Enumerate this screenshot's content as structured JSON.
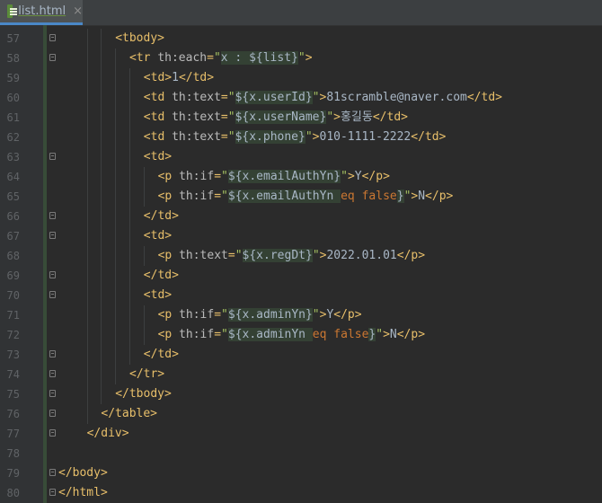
{
  "tab": {
    "filename": "list.html",
    "close": "×"
  },
  "editor": {
    "lines": [
      {
        "num": "57",
        "indent": 8,
        "fold": true,
        "tokens": [
          [
            "tag",
            "<tbody>"
          ]
        ]
      },
      {
        "num": "58",
        "indent": 10,
        "fold": true,
        "tokens": [
          [
            "tag",
            "<tr "
          ],
          [
            "attr",
            "th:each"
          ],
          [
            "tag",
            "="
          ],
          [
            "str",
            "\""
          ],
          [
            "expr",
            "x : ${list}"
          ],
          [
            "str",
            "\""
          ],
          [
            "tag",
            ">"
          ]
        ]
      },
      {
        "num": "59",
        "indent": 12,
        "fold": false,
        "tokens": [
          [
            "tag",
            "<td>"
          ],
          [
            "text",
            "1"
          ],
          [
            "tag",
            "</td>"
          ]
        ]
      },
      {
        "num": "60",
        "indent": 12,
        "fold": false,
        "tokens": [
          [
            "tag",
            "<td "
          ],
          [
            "attr",
            "th:text"
          ],
          [
            "tag",
            "="
          ],
          [
            "str",
            "\""
          ],
          [
            "expr",
            "${x.userId}"
          ],
          [
            "str",
            "\""
          ],
          [
            "tag",
            ">"
          ],
          [
            "text",
            "81scramble@naver.com"
          ],
          [
            "tag",
            "</td>"
          ]
        ]
      },
      {
        "num": "61",
        "indent": 12,
        "fold": false,
        "tokens": [
          [
            "tag",
            "<td "
          ],
          [
            "attr",
            "th:text"
          ],
          [
            "tag",
            "="
          ],
          [
            "str",
            "\""
          ],
          [
            "expr",
            "${x.userName}"
          ],
          [
            "str",
            "\""
          ],
          [
            "tag",
            ">"
          ],
          [
            "text",
            "홍길동"
          ],
          [
            "tag",
            "</td>"
          ]
        ]
      },
      {
        "num": "62",
        "indent": 12,
        "fold": false,
        "tokens": [
          [
            "tag",
            "<td "
          ],
          [
            "attr",
            "th:text"
          ],
          [
            "tag",
            "="
          ],
          [
            "str",
            "\""
          ],
          [
            "expr",
            "${x.phone}"
          ],
          [
            "str",
            "\""
          ],
          [
            "tag",
            ">"
          ],
          [
            "text",
            "010-1111-2222"
          ],
          [
            "tag",
            "</td>"
          ]
        ]
      },
      {
        "num": "63",
        "indent": 12,
        "fold": true,
        "tokens": [
          [
            "tag",
            "<td>"
          ]
        ]
      },
      {
        "num": "64",
        "indent": 14,
        "fold": false,
        "tokens": [
          [
            "tag",
            "<p "
          ],
          [
            "attr",
            "th:if"
          ],
          [
            "tag",
            "="
          ],
          [
            "str",
            "\""
          ],
          [
            "expr",
            "${x.emailAuthYn}"
          ],
          [
            "str",
            "\""
          ],
          [
            "tag",
            ">"
          ],
          [
            "text",
            "Y"
          ],
          [
            "tag",
            "</p>"
          ]
        ]
      },
      {
        "num": "65",
        "indent": 14,
        "fold": false,
        "tokens": [
          [
            "tag",
            "<p "
          ],
          [
            "attr",
            "th:if"
          ],
          [
            "tag",
            "="
          ],
          [
            "str",
            "\""
          ],
          [
            "expr",
            "${x.emailAuthYn "
          ],
          [
            "kw",
            "eq false"
          ],
          [
            "expr",
            "}"
          ],
          [
            "str",
            "\""
          ],
          [
            "tag",
            ">"
          ],
          [
            "text",
            "N"
          ],
          [
            "tag",
            "</p>"
          ]
        ]
      },
      {
        "num": "66",
        "indent": 12,
        "fold": true,
        "tokens": [
          [
            "tag",
            "</td>"
          ]
        ]
      },
      {
        "num": "67",
        "indent": 12,
        "fold": true,
        "tokens": [
          [
            "tag",
            "<td>"
          ]
        ]
      },
      {
        "num": "68",
        "indent": 14,
        "fold": false,
        "tokens": [
          [
            "tag",
            "<p "
          ],
          [
            "attr",
            "th:text"
          ],
          [
            "tag",
            "="
          ],
          [
            "str",
            "\""
          ],
          [
            "expr",
            "${x.regDt}"
          ],
          [
            "str",
            "\""
          ],
          [
            "tag",
            ">"
          ],
          [
            "text",
            "2022.01.01"
          ],
          [
            "tag",
            "</p>"
          ]
        ]
      },
      {
        "num": "69",
        "indent": 12,
        "fold": true,
        "tokens": [
          [
            "tag",
            "</td>"
          ]
        ]
      },
      {
        "num": "70",
        "indent": 12,
        "fold": true,
        "tokens": [
          [
            "tag",
            "<td>"
          ]
        ]
      },
      {
        "num": "71",
        "indent": 14,
        "fold": false,
        "tokens": [
          [
            "tag",
            "<p "
          ],
          [
            "attr",
            "th:if"
          ],
          [
            "tag",
            "="
          ],
          [
            "str",
            "\""
          ],
          [
            "expr",
            "${x.adminYn}"
          ],
          [
            "str",
            "\""
          ],
          [
            "tag",
            ">"
          ],
          [
            "text",
            "Y"
          ],
          [
            "tag",
            "</p>"
          ]
        ]
      },
      {
        "num": "72",
        "indent": 14,
        "fold": false,
        "tokens": [
          [
            "tag",
            "<p "
          ],
          [
            "attr",
            "th:if"
          ],
          [
            "tag",
            "="
          ],
          [
            "str",
            "\""
          ],
          [
            "expr",
            "${x.adminYn "
          ],
          [
            "kw",
            "eq false"
          ],
          [
            "expr",
            "}"
          ],
          [
            "str",
            "\""
          ],
          [
            "tag",
            ">"
          ],
          [
            "text",
            "N"
          ],
          [
            "tag",
            "</p>"
          ]
        ]
      },
      {
        "num": "73",
        "indent": 12,
        "fold": true,
        "tokens": [
          [
            "tag",
            "</td>"
          ]
        ]
      },
      {
        "num": "74",
        "indent": 10,
        "fold": true,
        "tokens": [
          [
            "tag",
            "</tr>"
          ]
        ]
      },
      {
        "num": "75",
        "indent": 8,
        "fold": true,
        "tokens": [
          [
            "tag",
            "</tbody>"
          ]
        ]
      },
      {
        "num": "76",
        "indent": 6,
        "fold": true,
        "tokens": [
          [
            "tag",
            "</table>"
          ]
        ]
      },
      {
        "num": "77",
        "indent": 4,
        "fold": true,
        "tokens": [
          [
            "tag",
            "</div>"
          ]
        ]
      },
      {
        "num": "78",
        "indent": 0,
        "fold": false,
        "tokens": []
      },
      {
        "num": "79",
        "indent": 0,
        "fold": true,
        "tokens": [
          [
            "tag",
            "</body>"
          ]
        ]
      },
      {
        "num": "80",
        "indent": 0,
        "fold": true,
        "tokens": [
          [
            "tag",
            "</html>"
          ]
        ]
      }
    ]
  }
}
